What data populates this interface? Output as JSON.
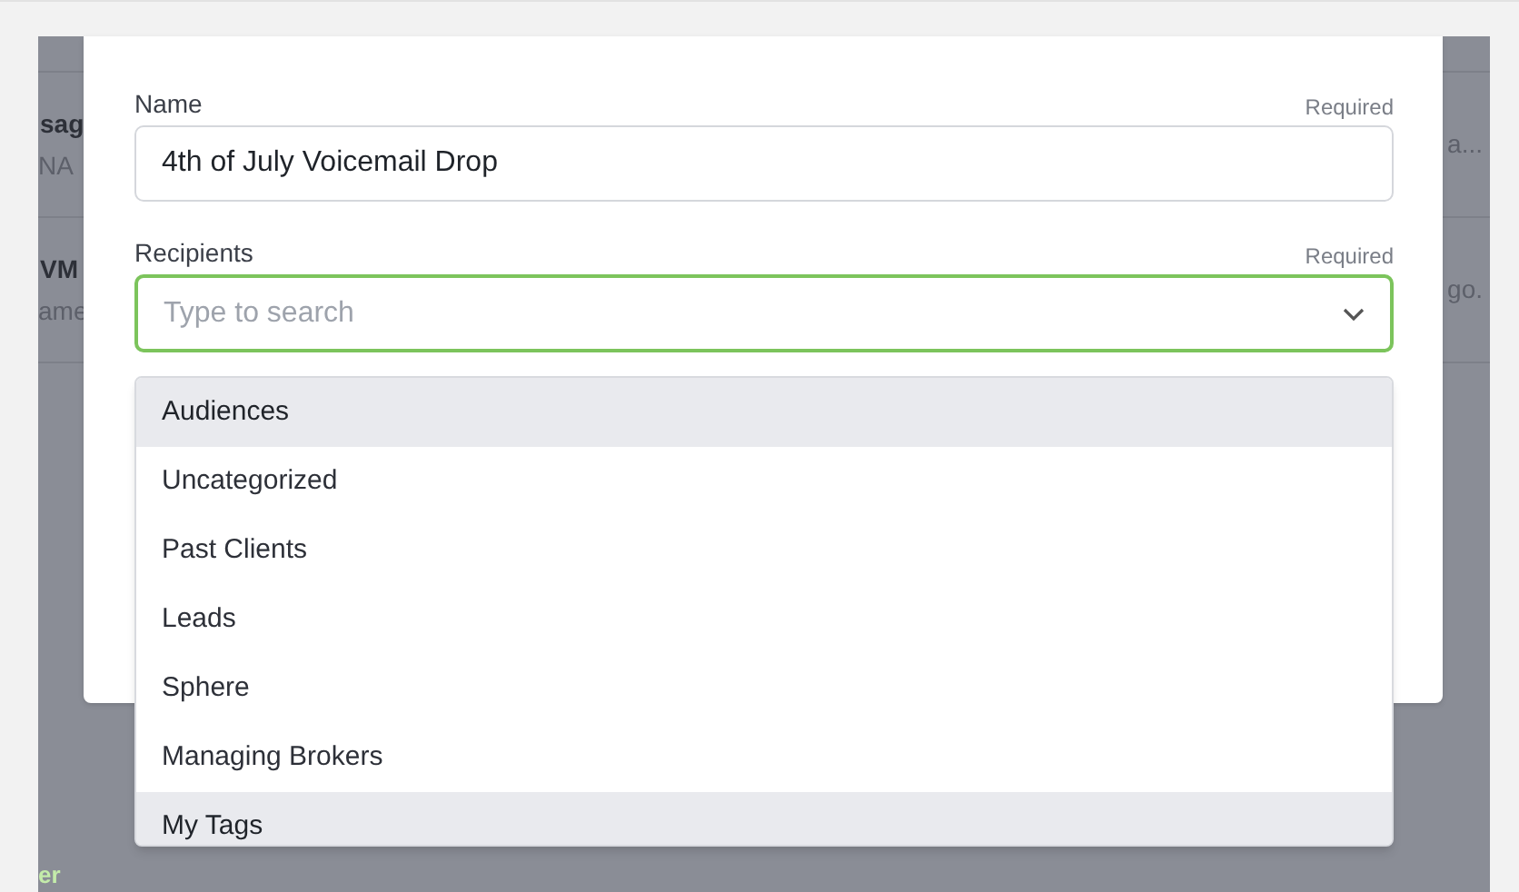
{
  "background": {
    "rows": [
      {
        "title": "sag",
        "subtitle": "NA",
        "trailing": "a..."
      },
      {
        "title": "VM",
        "subtitle": "ame",
        "trailing": "go."
      }
    ],
    "footer_link": "er"
  },
  "modal": {
    "fields": [
      {
        "label": "Name",
        "hint": "Required",
        "value": "4th of July Voicemail Drop",
        "focused": false,
        "kind": "text"
      },
      {
        "label": "Recipients",
        "hint": "Required",
        "placeholder": "Type to search",
        "focused": true,
        "kind": "select"
      }
    ]
  },
  "dropdown": {
    "items": [
      {
        "kind": "header",
        "label": "Audiences"
      },
      {
        "kind": "option",
        "label": "Uncategorized"
      },
      {
        "kind": "option",
        "label": "Past Clients"
      },
      {
        "kind": "option",
        "label": "Leads"
      },
      {
        "kind": "option",
        "label": "Sphere"
      },
      {
        "kind": "option",
        "label": "Managing Brokers"
      },
      {
        "kind": "header",
        "label": "My Tags"
      }
    ]
  }
}
